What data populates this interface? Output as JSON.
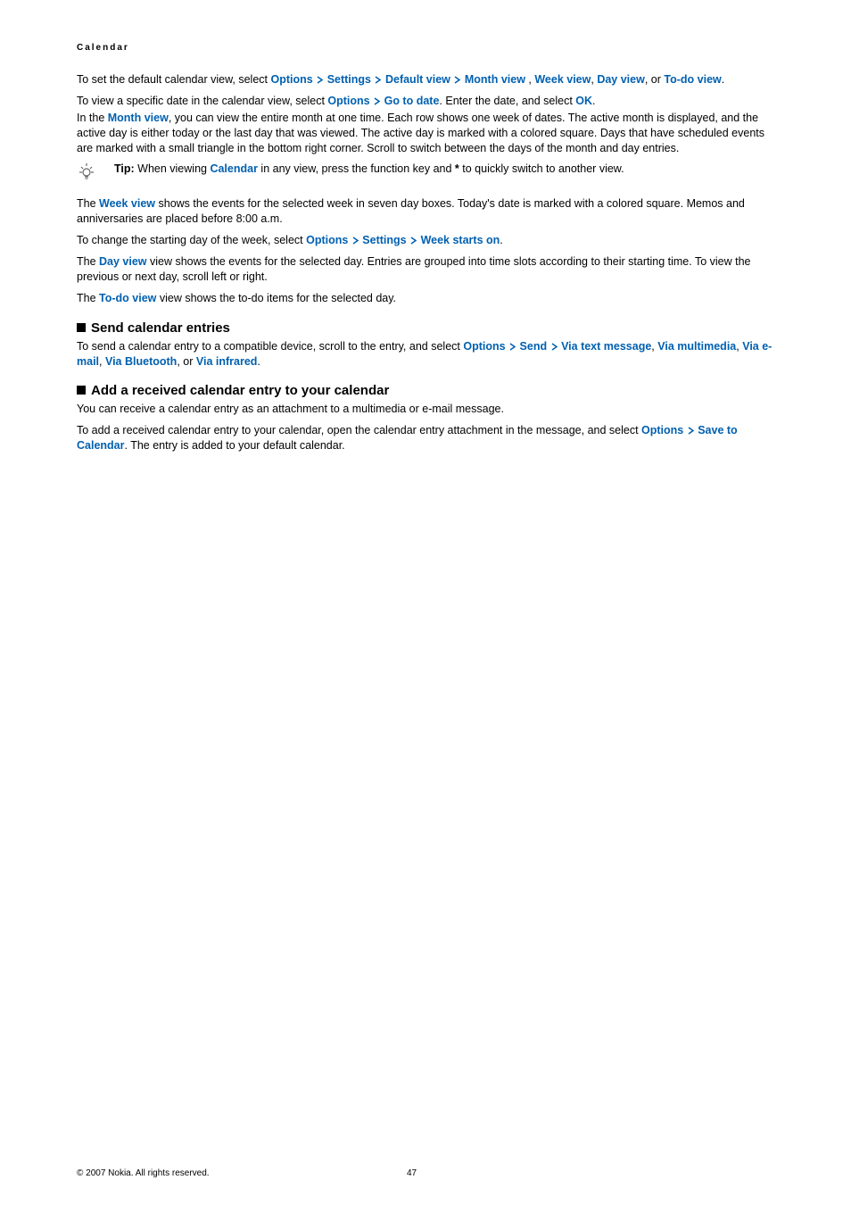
{
  "header": "Calendar",
  "para1_a": "To set the default calendar view, select ",
  "para1_b": " , ",
  "para1_c": ", ",
  "para1_d": ", or ",
  "para1_e": ".",
  "tokens": {
    "options": "Options",
    "settings": "Settings",
    "defaultView": "Default view",
    "monthView": "Month view",
    "weekView": "Week view",
    "dayView": "Day view",
    "todoView": "To-do view",
    "gotoDate": "Go to date",
    "ok": "OK",
    "calendar": "Calendar",
    "weekStartsOn": "Week starts on",
    "send": "Send",
    "viaTextMessage": "Via text message",
    "viaMultimedia": "Via multimedia",
    "viaEmail": "Via e-mail",
    "viaBluetooth": "Via Bluetooth",
    "viaInfrared": "Via infrared",
    "saveToCalendar": "Save to Calendar"
  },
  "para2_a": "To view a specific date in the calendar view, select ",
  "para2_b": ". Enter the date, and select ",
  "para2_c": ".",
  "para3_a": "In the ",
  "para3_b": ", you can view the entire month at one time. Each row shows one week of dates. The active month is displayed, and the active day is either today or the last day that was viewed. The active day is marked with a colored square. Days that have scheduled events are marked with a small triangle in the bottom right corner. Scroll to switch between the days of the month and day entries.",
  "tip_label": "Tip:  ",
  "tip_a": "When viewing ",
  "tip_b": " in any view, press the function key and ",
  "tip_star": "*",
  "tip_c": " to quickly switch to another view.",
  "para4_a": "The ",
  "para4_b": " shows the events for the selected week in seven day boxes. Today's date is marked with a colored square. Memos and anniversaries are placed before 8:00 a.m.",
  "para5_a": "To change the starting day of the week, select ",
  "para5_b": ".",
  "para6_a": "The ",
  "para6_b": " view shows the events for the selected day. Entries are grouped into time slots according to their starting time. To view the previous or next day, scroll left or right.",
  "para7_a": "The ",
  "para7_b": " view shows the to-do items for the selected day.",
  "heading1": "Send calendar entries",
  "para8_a": "To send a calendar entry to a compatible device, scroll to the entry, and select ",
  "para8_b": ", ",
  "para8_c": ", or ",
  "para8_d": ".",
  "heading2": "Add a received calendar entry to your calendar",
  "para9": "You can receive a calendar entry as an attachment to a multimedia or e-mail message.",
  "para10_a": "To add a received calendar entry to your calendar, open the calendar entry attachment in the message, and select ",
  "para10_b": ". The entry is added to your default calendar.",
  "footer_copyright": "© 2007 Nokia. All rights reserved.",
  "footer_page": "47"
}
